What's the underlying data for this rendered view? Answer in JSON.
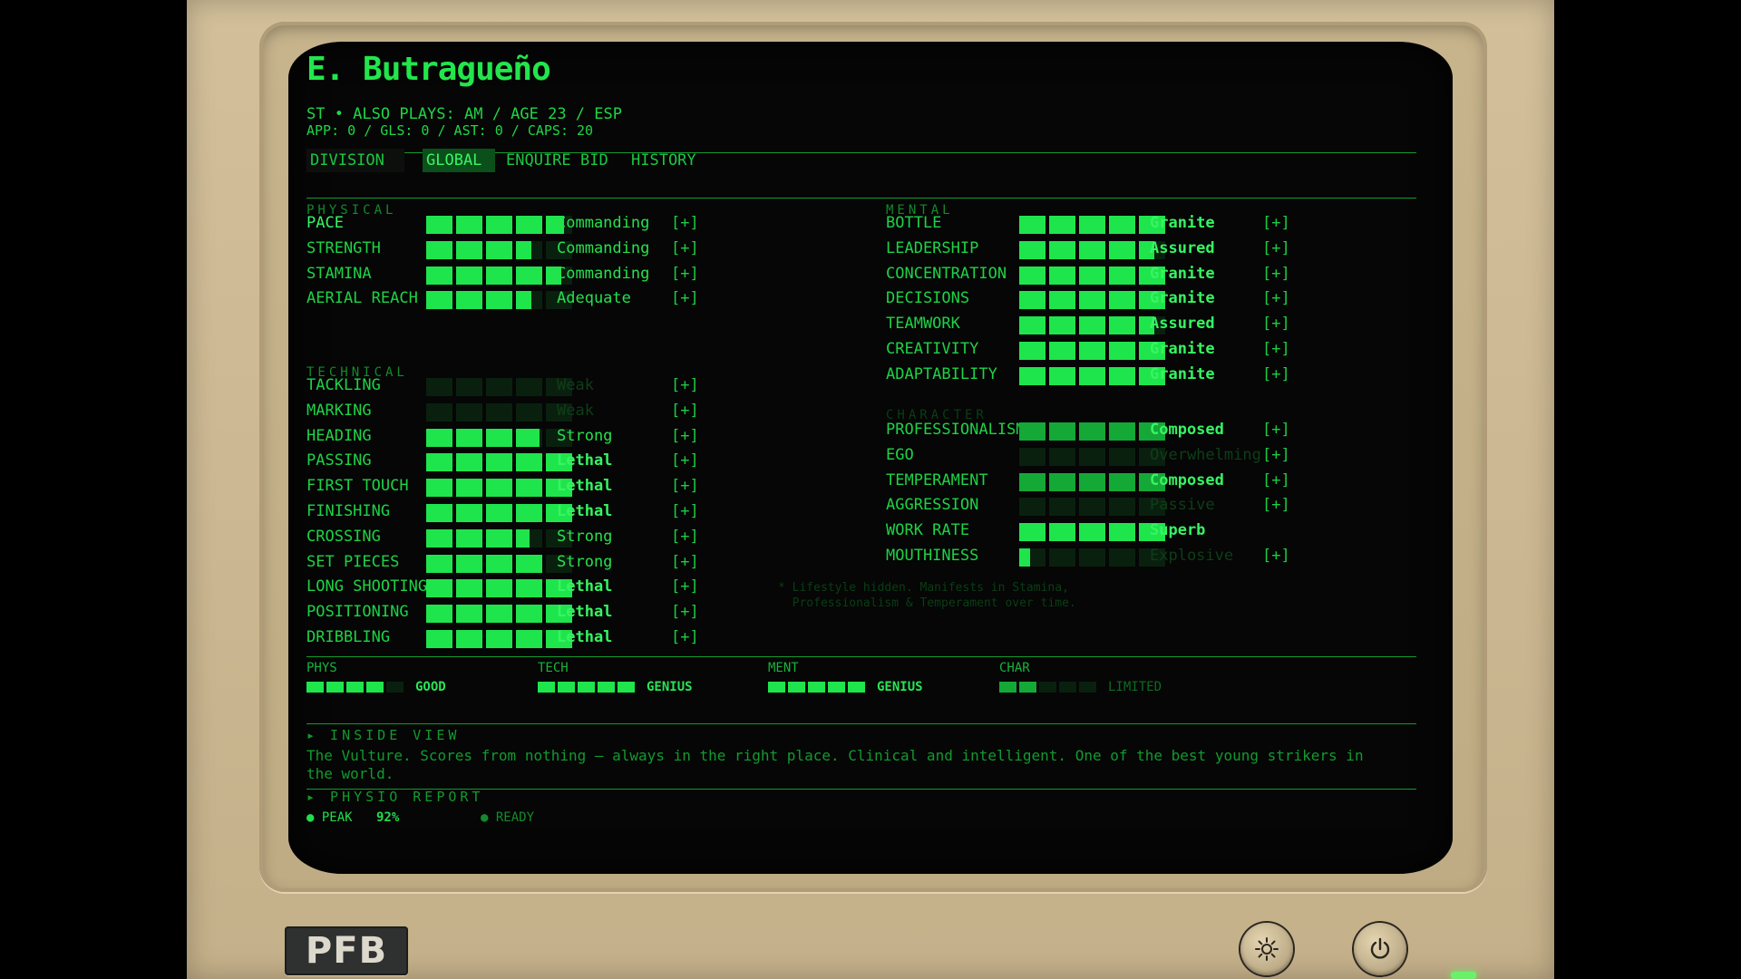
{
  "player": {
    "name": "E. Butragueño",
    "line1": "ST  •  ALSO PLAYS: AM  /  AGE 23  /  ESP",
    "line2": "APP: 0  /  GLS: 0  /  AST: 0  /  CAPS: 20"
  },
  "tabs": [
    {
      "label": "DIVISION",
      "state": "dim"
    },
    {
      "label": "GLOBAL",
      "state": "active"
    },
    {
      "label": "ENQUIRE",
      "state": "normal"
    },
    {
      "label": "BID",
      "state": "normal"
    },
    {
      "label": "HISTORY",
      "state": "normal"
    }
  ],
  "sections": {
    "physical": "PHYSICAL",
    "technical": "TECHNICAL",
    "mental": "MENTAL",
    "character": "CHARACTER"
  },
  "plus_label": "[+]",
  "physical": [
    {
      "label": "PACE",
      "level": 4.7,
      "desc": "Commanding",
      "bright": true
    },
    {
      "label": "STRENGTH",
      "level": 3.6,
      "desc": "Commanding"
    },
    {
      "label": "STAMINA",
      "level": 4.6,
      "desc": "Commanding"
    },
    {
      "label": "AERIAL REACH",
      "level": 3.6,
      "desc": "Adequate"
    }
  ],
  "technical": [
    {
      "label": "TACKLING",
      "level": 0,
      "desc": "Weak",
      "faint": true
    },
    {
      "label": "MARKING",
      "level": 0,
      "desc": "Weak",
      "faint": true
    },
    {
      "label": "HEADING",
      "level": 3.9,
      "desc": "Strong"
    },
    {
      "label": "PASSING",
      "level": 5,
      "desc": "Lethal",
      "bold": true
    },
    {
      "label": "FIRST TOUCH",
      "level": 5,
      "desc": "Lethal",
      "bold": true
    },
    {
      "label": "FINISHING",
      "level": 5,
      "desc": "Lethal",
      "bold": true
    },
    {
      "label": "CROSSING",
      "level": 3.5,
      "desc": "Strong"
    },
    {
      "label": "SET PIECES",
      "level": 4,
      "desc": "Strong"
    },
    {
      "label": "LONG SHOOTING",
      "level": 5,
      "desc": "Lethal",
      "bold": true
    },
    {
      "label": "POSITIONING",
      "level": 5,
      "desc": "Lethal",
      "bold": true
    },
    {
      "label": "DRIBBLING",
      "level": 5,
      "desc": "Lethal",
      "bold": true
    }
  ],
  "mental": [
    {
      "label": "BOTTLE",
      "level": 5,
      "desc": "Granite",
      "bold": true
    },
    {
      "label": "LEADERSHIP",
      "level": 4.6,
      "desc": "Assured",
      "bold": true
    },
    {
      "label": "CONCENTRATION",
      "level": 5,
      "desc": "Granite",
      "bold": true
    },
    {
      "label": "DECISIONS",
      "level": 5,
      "desc": "Granite",
      "bold": true
    },
    {
      "label": "TEAMWORK",
      "level": 4.6,
      "desc": "Assured",
      "bold": true
    },
    {
      "label": "CREATIVITY",
      "level": 5,
      "desc": "Granite",
      "bold": true
    },
    {
      "label": "ADAPTABILITY",
      "level": 5,
      "desc": "Granite",
      "bold": true
    }
  ],
  "character": [
    {
      "label": "PROFESSIONALISM",
      "level": 5,
      "desc": "Composed",
      "bold": true,
      "dim": true,
      "plus": true
    },
    {
      "label": "EGO",
      "level": 0,
      "desc": "Overwhelming",
      "faint": true,
      "plus": true
    },
    {
      "label": "TEMPERAMENT",
      "level": 5,
      "desc": "Composed",
      "bold": true,
      "dim": true,
      "plus": true
    },
    {
      "label": "AGGRESSION",
      "level": 0,
      "desc": "Passive",
      "faint": true,
      "plus": true
    },
    {
      "label": "WORK RATE",
      "level": 5,
      "desc": "Superb",
      "bold": true,
      "plus": false
    },
    {
      "label": "MOUTHINESS",
      "level": 0.4,
      "desc": "Explosive",
      "faint": true,
      "plus": true
    }
  ],
  "lifestyle_note": "* Lifestyle hidden. Manifests in Stamina,\n  Professionalism & Temperament over time.",
  "summary": [
    {
      "label": "PHYS",
      "filled": 4,
      "value": "GOOD",
      "faint": false
    },
    {
      "label": "TECH",
      "filled": 5,
      "value": "GENIUS",
      "faint": false
    },
    {
      "label": "MENT",
      "filled": 5,
      "value": "GENIUS",
      "faint": false
    },
    {
      "label": "CHAR",
      "filled": 2,
      "value": "LIMITED",
      "faint": true
    }
  ],
  "inside_view": {
    "header": "▸ INSIDE VIEW",
    "text": "The Vulture. Scores from nothing — always in the right place. Clinical and intelligent. One of the best young strikers in the world."
  },
  "physio": {
    "header": "▸ PHYSIO REPORT",
    "status": "● PEAK",
    "percent": "92%",
    "ready": "● READY"
  },
  "hardware": {
    "logo": "PFB",
    "brightness_icon": "brightness-icon",
    "power_icon": "power-icon"
  },
  "colors": {
    "phosphor": "#1fe54c",
    "bezel": "#cbb791",
    "screen": "#050605"
  }
}
